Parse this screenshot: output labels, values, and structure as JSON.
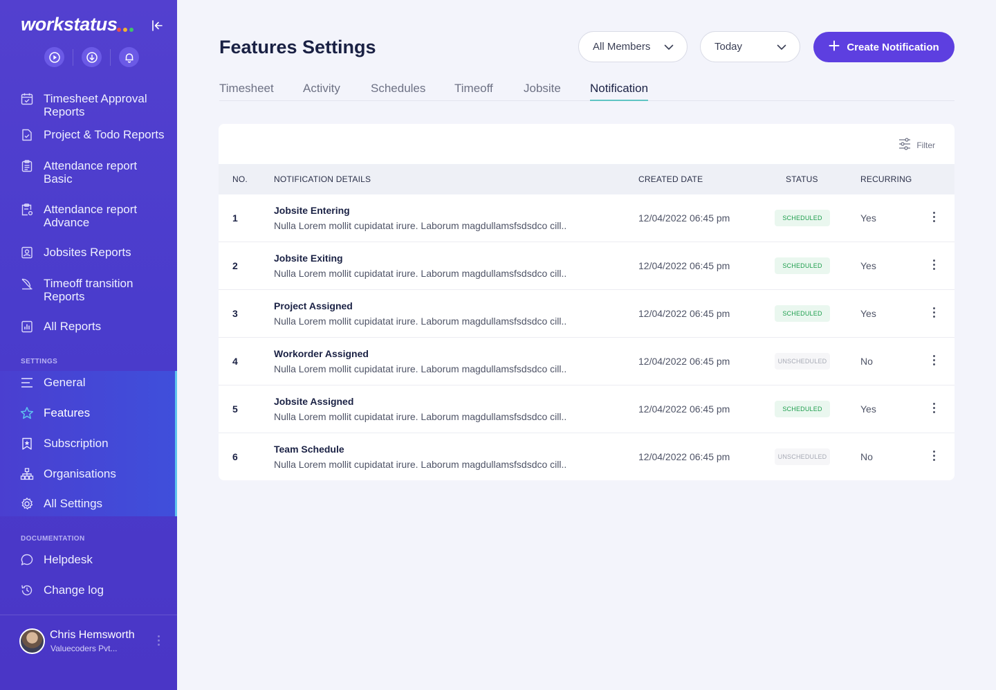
{
  "brand": {
    "name": "workstatus",
    "dot_colors": [
      "#e8514a",
      "#f2b233",
      "#3fc36a"
    ]
  },
  "sidebar": {
    "quick_icons": [
      "play-icon",
      "download-icon",
      "bell-icon"
    ],
    "reports": [
      {
        "label_line1": "Timesheet Approval",
        "label_line2": "Reports",
        "icon": "calendar-check-icon"
      },
      {
        "label_line1": "Project & Todo Reports",
        "label_line2": "",
        "icon": "document-check-icon"
      },
      {
        "label_line1": "Attendance report",
        "label_line2": "Basic",
        "icon": "clipboard-icon"
      },
      {
        "label_line1": "Attendance report",
        "label_line2": "Advance",
        "icon": "clipboard-settings-icon"
      },
      {
        "label_line1": "Jobsites Reports",
        "label_line2": "",
        "icon": "map-user-icon"
      },
      {
        "label_line1": "Timeoff transition",
        "label_line2": "Reports",
        "icon": "beach-icon"
      },
      {
        "label_line1": "All Reports",
        "label_line2": "",
        "icon": "bar-chart-icon"
      }
    ],
    "settings_label": "SETTINGS",
    "settings": [
      {
        "label": "General",
        "icon": "menu-lines-icon"
      },
      {
        "label": "Features",
        "icon": "star-icon"
      },
      {
        "label": "Subscription",
        "icon": "bookmark-star-icon"
      },
      {
        "label": "Organisations",
        "icon": "org-chart-icon"
      },
      {
        "label": "All Settings",
        "icon": "gear-icon"
      }
    ],
    "documentation_label": "DOCUMENTATION",
    "documentation": [
      {
        "label": "Helpdesk",
        "icon": "chat-bubble-icon"
      },
      {
        "label": "Change log",
        "icon": "history-icon"
      }
    ],
    "user": {
      "name": "Chris Hemsworth",
      "org": "Valuecoders Pvt..."
    }
  },
  "header": {
    "title": "Features Settings",
    "members_select": "All Members",
    "date_select": "Today",
    "create_label": "Create Notification"
  },
  "tabs": [
    "Timesheet",
    "Activity",
    "Schedules",
    "Timeoff",
    "Jobsite",
    "Notification"
  ],
  "active_tab": "Notification",
  "table": {
    "filter_label": "Filter",
    "columns": [
      "NO.",
      "NOTIFICATION DETAILS",
      "CREATED DATE",
      "STATUS",
      "RECURRING"
    ],
    "rows": [
      {
        "no": "1",
        "title": "Jobsite Entering",
        "desc": "Nulla Lorem mollit cupidatat irure. Laborum magdullamsfsdsdco cill..",
        "date": "12/04/2022 06:45 pm",
        "status": "SCHEDULED",
        "recurring": "Yes"
      },
      {
        "no": "2",
        "title": "Jobsite Exiting",
        "desc": "Nulla Lorem mollit cupidatat irure. Laborum magdullamsfsdsdco cill..",
        "date": "12/04/2022 06:45 pm",
        "status": "SCHEDULED",
        "recurring": "Yes"
      },
      {
        "no": "3",
        "title": "Project Assigned",
        "desc": "Nulla Lorem mollit cupidatat irure. Laborum magdullamsfsdsdco cill..",
        "date": "12/04/2022 06:45 pm",
        "status": "SCHEDULED",
        "recurring": "Yes"
      },
      {
        "no": "4",
        "title": "Workorder Assigned",
        "desc": "Nulla Lorem mollit cupidatat irure. Laborum magdullamsfsdsdco cill..",
        "date": "12/04/2022 06:45 pm",
        "status": "UNSCHEDULED",
        "recurring": "No"
      },
      {
        "no": "5",
        "title": "Jobsite Assigned",
        "desc": "Nulla Lorem mollit cupidatat irure. Laborum magdullamsfsdsdco cill..",
        "date": "12/04/2022 06:45 pm",
        "status": "SCHEDULED",
        "recurring": "Yes"
      },
      {
        "no": "6",
        "title": "Team Schedule",
        "desc": "Nulla Lorem mollit cupidatat irure. Laborum magdullamsfsdsdco cill..",
        "date": "12/04/2022 06:45 pm",
        "status": "UNSCHEDULED",
        "recurring": "No"
      }
    ]
  },
  "colors": {
    "sidebar": "#4f3ccc",
    "accent": "#5d3fe0",
    "scheduled": "#1e9e4d",
    "tab_underline": "#5fc4c4"
  }
}
